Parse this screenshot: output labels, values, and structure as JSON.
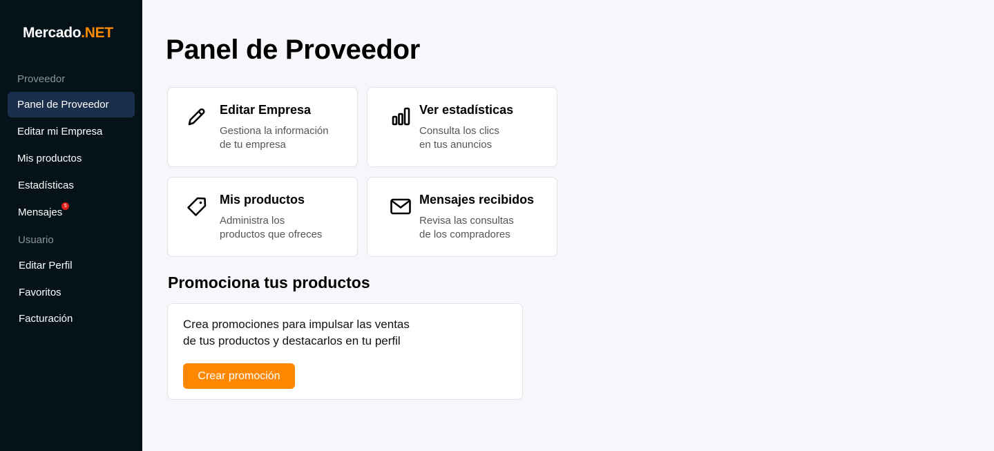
{
  "app": {
    "logo_main": "Mercado",
    "logo_accent": ".NET",
    "accent_color": "#ff8a00"
  },
  "sidebar": {
    "section_provider": "Proveedor",
    "provider_items": [
      {
        "label": "Panel de Proveedor",
        "active": true
      },
      {
        "label": "Editar mi Empresa"
      },
      {
        "label": "Mis productos"
      },
      {
        "label": "Estadísticas"
      },
      {
        "label": "Mensajes",
        "badge": "5"
      }
    ],
    "section_user": "Usuario",
    "user_items": [
      {
        "label": "Editar Perfil"
      },
      {
        "label": "Favoritos"
      },
      {
        "label": "Facturación"
      }
    ]
  },
  "main": {
    "title": "Panel de Proveedor",
    "cards": [
      {
        "icon": "pencil-icon",
        "title": "Editar Empresa",
        "desc_line1": "Gestiona la información",
        "desc_line2": "de tu empresa"
      },
      {
        "icon": "bar-chart-icon",
        "title": "Ver estadísticas",
        "desc_line1": "Consulta los clics",
        "desc_line2": "en tus anuncios"
      },
      {
        "icon": "tag-icon",
        "title": "Mis productos",
        "desc_line1": "Administra los",
        "desc_line2": "productos que ofreces"
      },
      {
        "icon": "mail-icon",
        "title": "Mensajes recibidos",
        "desc_line1": "Revisa las consultas",
        "desc_line2": "de los compradores"
      }
    ],
    "promo": {
      "heading": "Promociona tus productos",
      "text_line1": "Crea promociones para impulsar las ventas",
      "text_line2": "de tus productos y destacarlos en tu perfil",
      "button_label": "Crear promoción"
    }
  }
}
